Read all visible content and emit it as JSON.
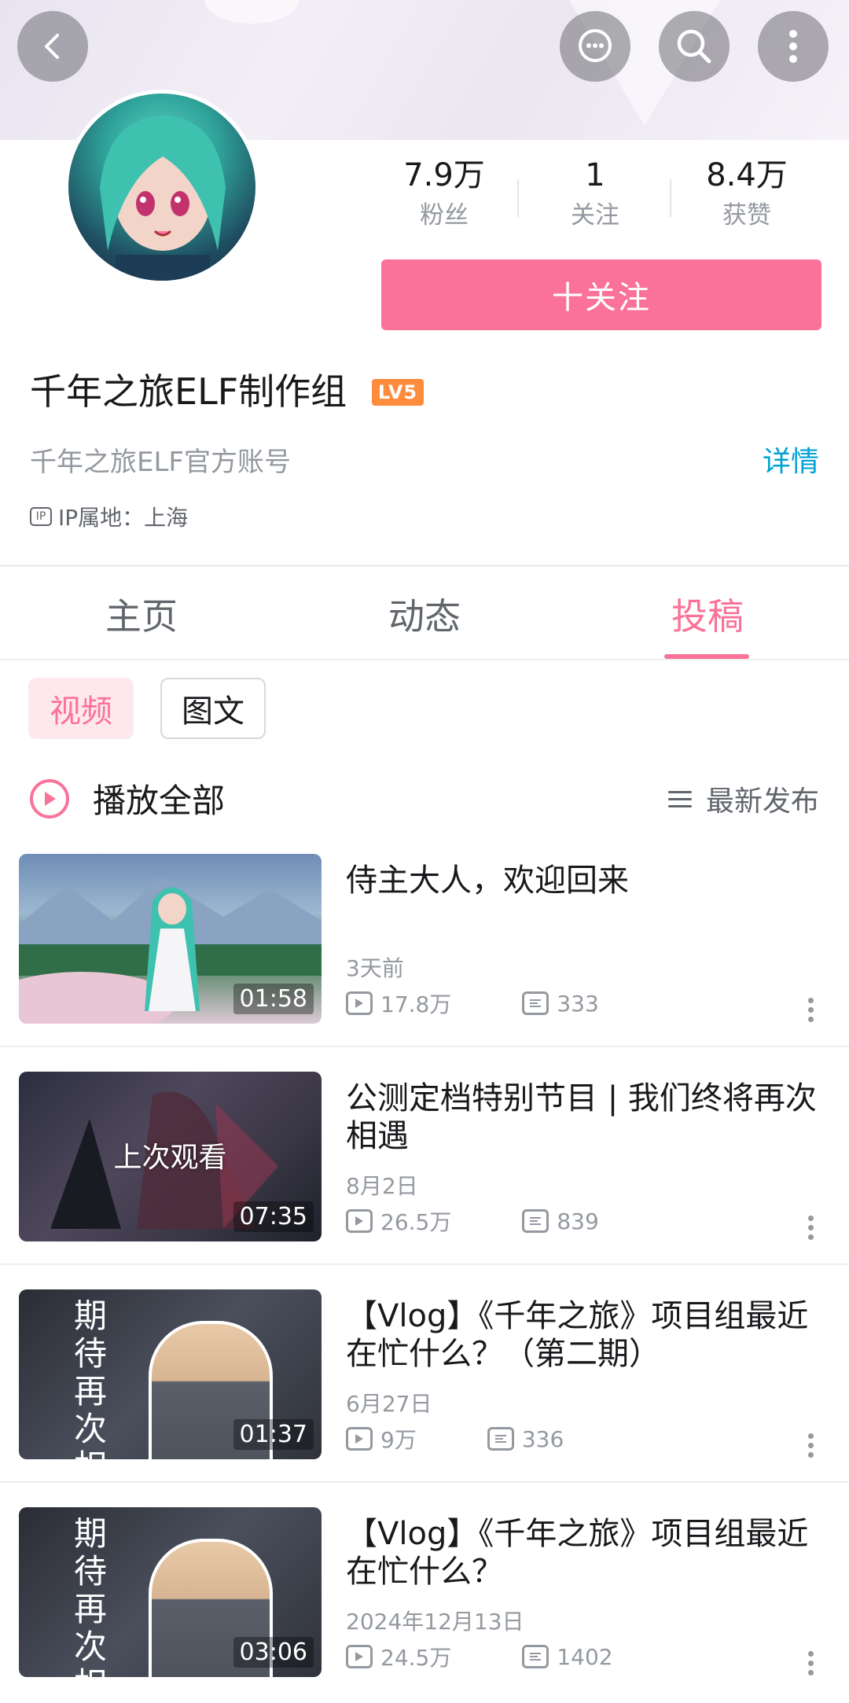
{
  "stats": [
    {
      "value": "7.9万",
      "label": "粉丝"
    },
    {
      "value": "1",
      "label": "关注"
    },
    {
      "value": "8.4万",
      "label": "获赞"
    }
  ],
  "follow_label": "十关注",
  "profile": {
    "name": "千年之旅ELF制作组",
    "level": "LV5",
    "signature": "千年之旅ELF官方账号",
    "detail_label": "详情",
    "ip_badge": "IP",
    "ip_location": "IP属地：上海"
  },
  "tabs": [
    "主页",
    "动态",
    "投稿"
  ],
  "active_tab": "投稿",
  "filters": {
    "video": "视频",
    "text": "图文"
  },
  "play_all_label": "播放全部",
  "sort_label": "最新发布",
  "videos": [
    {
      "title": "侍主大人，欢迎回来",
      "date": "3天前",
      "views": "17.8万",
      "comments": "333",
      "duration": "01:58",
      "overlay": ""
    },
    {
      "title": "公测定档特别节目 | 我们终将再次相遇",
      "date": "8月2日",
      "views": "26.5万",
      "comments": "839",
      "duration": "07:35",
      "overlay": "上次观看"
    },
    {
      "title": "【Vlog】《千年之旅》项目组最近在忙什么？（第二期）",
      "date": "6月27日",
      "views": "9万",
      "comments": "336",
      "duration": "01:37",
      "overlay": ""
    },
    {
      "title": "【Vlog】《千年之旅》项目组最近在忙什么？",
      "date": "2024年12月13日",
      "views": "24.5万",
      "comments": "1402",
      "duration": "03:06",
      "overlay": ""
    }
  ],
  "thumb_text": "期待再次相遇",
  "colors": {
    "accent": "#fb7299",
    "link": "#00a1d6",
    "level_badge": "#ff8b3d"
  }
}
